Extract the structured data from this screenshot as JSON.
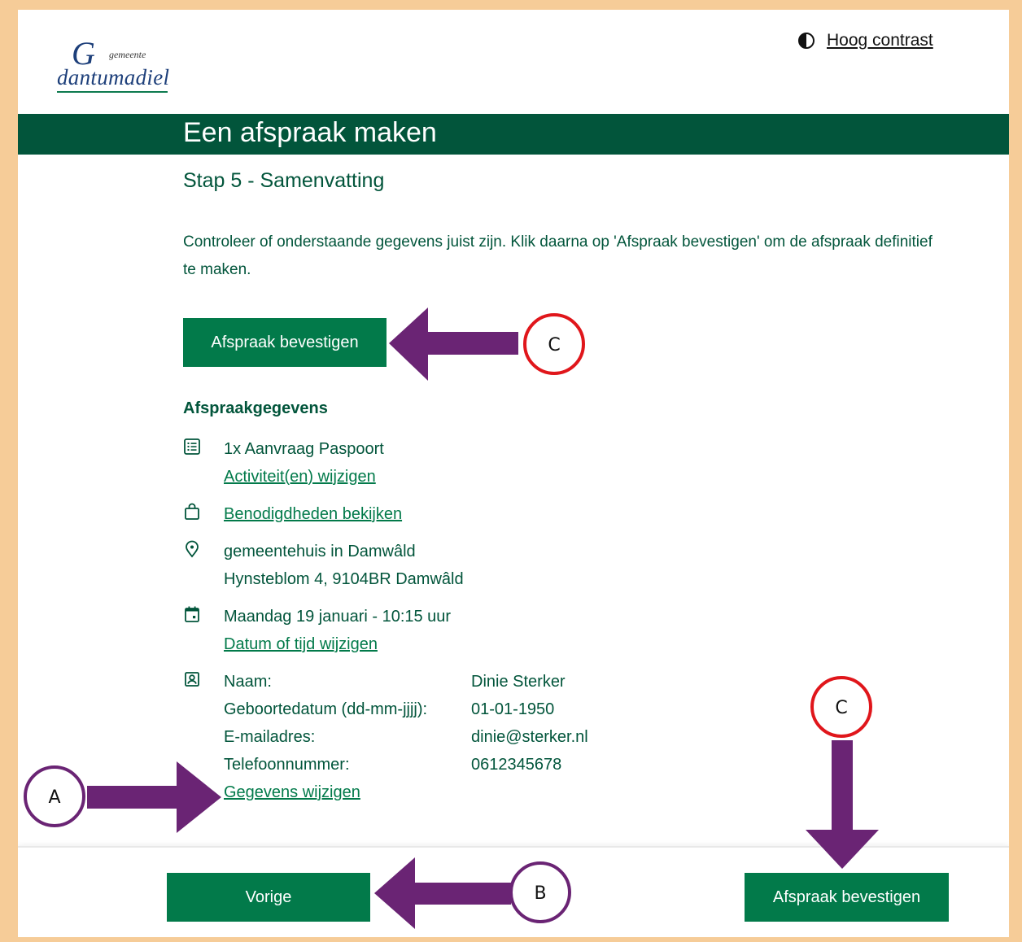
{
  "header": {
    "logo_gemeente": "gemeente",
    "logo_name": "dantumadiel",
    "contrast_label": "Hoog contrast"
  },
  "page": {
    "title": "Een afspraak maken",
    "step": "Stap 5 - Samenvatting",
    "intro": "Controleer of onderstaande gegevens juist zijn. Klik daarna op 'Afspraak bevestigen' om de afspraak definitief te maken.",
    "confirm_label": "Afspraak bevestigen"
  },
  "details": {
    "section_title": "Afspraakgegevens",
    "activity": "1x Aanvraag Paspoort",
    "activity_link": "Activiteit(en) wijzigen",
    "requirements_link": "Benodigdheden bekijken",
    "location_name": "gemeentehuis in Damwâld",
    "location_address": "Hynsteblom 4, 9104BR Damwâld",
    "datetime": "Maandag 19 januari - 10:15 uur",
    "datetime_link": "Datum of tijd wijzigen",
    "person": {
      "name_label": "Naam:",
      "name_value": "Dinie Sterker",
      "dob_label": "Geboortedatum (dd-mm-jjjj):",
      "dob_value": "01-01-1950",
      "email_label": "E-mailadres:",
      "email_value": "dinie@sterker.nl",
      "phone_label": "Telefoonnummer:",
      "phone_value": "0612345678"
    },
    "person_link": "Gegevens wijzigen"
  },
  "footer": {
    "prev_label": "Vorige",
    "confirm_label": "Afspraak bevestigen"
  },
  "annotations": {
    "label_a": "A",
    "label_b": "B",
    "label_c_top": "C",
    "label_c_bottom": "C",
    "arrow_color": "#6a2474",
    "circle_red": "#e0161b",
    "circle_purple": "#6a2474"
  },
  "colors": {
    "dark_green": "#02553b",
    "button_green": "#027a4a",
    "page_frame": "#f6cc98"
  }
}
